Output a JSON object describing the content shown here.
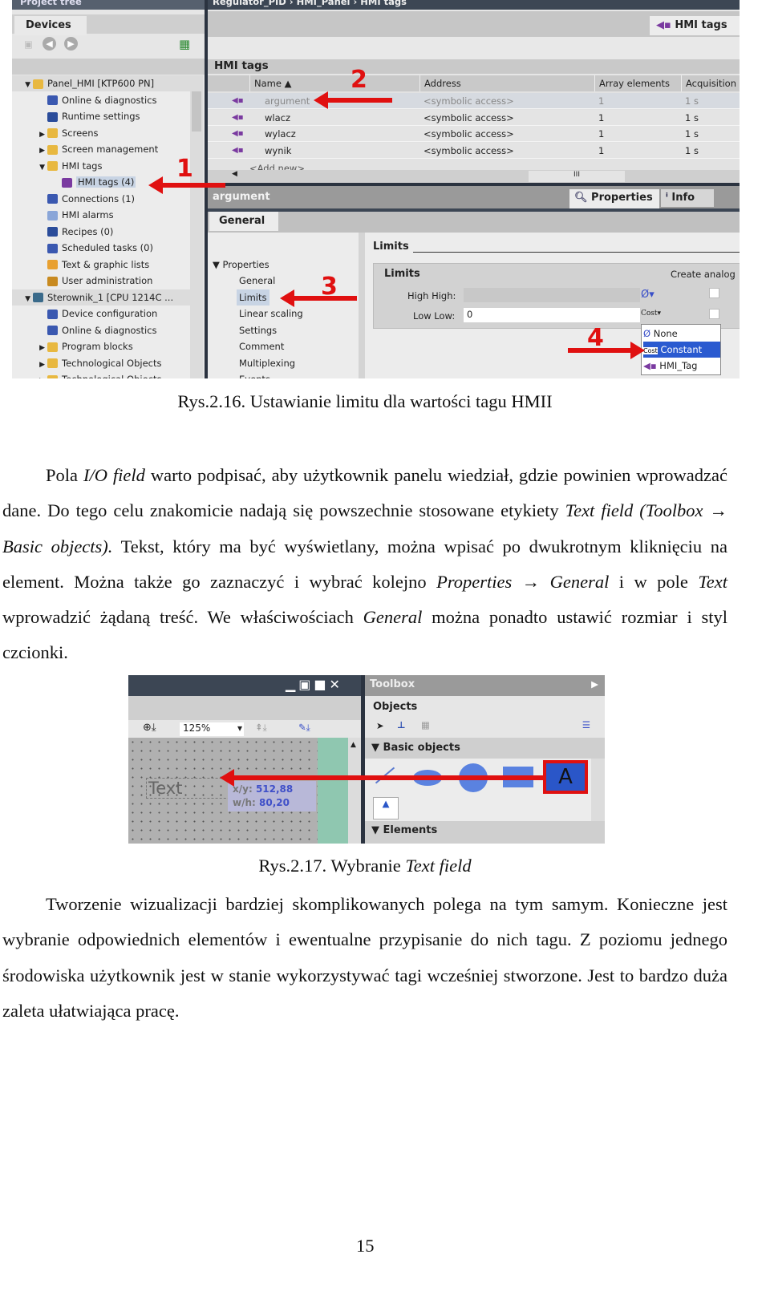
{
  "figure1": {
    "title_bar": "Project tree",
    "breadcrumb": "Regulator_PID  ›  HMI_Panel  ›  HMI tags",
    "devices_tab": "Devices",
    "tree": [
      {
        "label": "Panel_HMI [KTP600 PN]",
        "level": 0,
        "exp": "▼",
        "icon": "folder-icon",
        "color": "#e8b840",
        "sel": true
      },
      {
        "label": "Online & diagnostics",
        "level": 1,
        "exp": "",
        "icon": "diagnostics-icon",
        "color": "#3a58b0"
      },
      {
        "label": "Runtime settings",
        "level": 1,
        "exp": "",
        "icon": "wrench-icon",
        "color": "#2a4c9a"
      },
      {
        "label": "Screens",
        "level": 1,
        "exp": "▶",
        "icon": "folder-icon",
        "color": "#e8b840"
      },
      {
        "label": "Screen management",
        "level": 1,
        "exp": "▶",
        "icon": "folder-icon",
        "color": "#e8b840"
      },
      {
        "label": "HMI tags",
        "level": 1,
        "exp": "▼",
        "icon": "folder-icon",
        "color": "#e8b840"
      },
      {
        "label": "HMI tags (4)",
        "level": 2,
        "exp": "",
        "icon": "tag-icon",
        "color": "#7a3aa0",
        "hl": true
      },
      {
        "label": "Connections (1)",
        "level": 1,
        "exp": "",
        "icon": "connections-icon",
        "color": "#3a58b0"
      },
      {
        "label": "HMI alarms",
        "level": 1,
        "exp": "",
        "icon": "envelope-icon",
        "color": "#8aa6d8"
      },
      {
        "label": "Recipes (0)",
        "level": 1,
        "exp": "",
        "icon": "recipes-icon",
        "color": "#2a4c9a"
      },
      {
        "label": "Scheduled tasks (0)",
        "level": 1,
        "exp": "",
        "icon": "calendar-icon",
        "color": "#3a58b0"
      },
      {
        "label": "Text & graphic lists",
        "level": 1,
        "exp": "",
        "icon": "list-icon",
        "color": "#e8a030"
      },
      {
        "label": "User administration",
        "level": 1,
        "exp": "",
        "icon": "users-icon",
        "color": "#c88a20"
      },
      {
        "label": "Sterownik_1 [CPU 1214C ...",
        "level": 0,
        "exp": "▼",
        "icon": "cpu-icon",
        "color": "#3a6a8a",
        "sel": true
      },
      {
        "label": "Device configuration",
        "level": 1,
        "exp": "",
        "icon": "device-config-icon",
        "color": "#3a58b0"
      },
      {
        "label": "Online & diagnostics",
        "level": 1,
        "exp": "",
        "icon": "diagnostics-icon",
        "color": "#3a58b0"
      },
      {
        "label": "Program blocks",
        "level": 1,
        "exp": "▶",
        "icon": "folder-icon",
        "color": "#e8b840"
      },
      {
        "label": "Technological Objects",
        "level": 1,
        "exp": "▶",
        "icon": "folder-icon",
        "color": "#e8b840"
      },
      {
        "label": "Technological Objects",
        "level": 1,
        "exp": "▶",
        "icon": "folder-icon",
        "color": "#e8b840"
      }
    ],
    "editor_title": "HMI tags",
    "editor_tab": "HMI tags",
    "columns": [
      "Name ▲",
      "Address",
      "Array elements",
      "Acquisition c"
    ],
    "rows": [
      {
        "name": "argument",
        "address": "<symbolic access>",
        "array": "1",
        "acq": "1 s"
      },
      {
        "name": "wlacz",
        "address": "<symbolic access>",
        "array": "1",
        "acq": "1 s"
      },
      {
        "name": "wylacz",
        "address": "<symbolic access>",
        "array": "1",
        "acq": "1 s"
      },
      {
        "name": "wynik",
        "address": "<symbolic access>",
        "array": "1",
        "acq": "1 s"
      }
    ],
    "add_new": "<Add new>",
    "inspector_title": "argument",
    "tab_properties": "Properties",
    "tab_info": "Info",
    "general_tab": "General",
    "nav_group": "Properties",
    "nav_items": [
      "General",
      "Limits",
      "Linear scaling",
      "Settings",
      "Comment",
      "Multiplexing",
      "Events"
    ],
    "section_title": "Limits",
    "group_title": "Limits",
    "create_analog": "Create analog",
    "high_high_label": "High High:",
    "low_low_label": "Low Low:",
    "low_low_value": "0",
    "dropdown": [
      "None",
      "Constant",
      "HMI_Tag"
    ],
    "const_icon": "Cost",
    "markers": [
      "1",
      "2",
      "3",
      "4"
    ]
  },
  "caption1": "Rys.2.16. Ustawianie limitu dla wartości tagu HMII",
  "paragraph1": [
    {
      "t": "Pola ",
      "i": false
    },
    {
      "t": "I/O field",
      "i": true
    },
    {
      "t": " warto podpisać, aby użytkownik panelu wiedział, gdzie powinien wprowadzać dane. Do tego celu znakomicie nadają się powszechnie stosowane etykiety ",
      "i": false
    },
    {
      "t": "Text field (Toolbox → Basic objects).",
      "i": true
    },
    {
      "t": " Tekst, który ma być wyświetlany, można wpisać po dwukrotnym kliknięciu na element. Można także go zaznaczyć i wybrać kolejno ",
      "i": false
    },
    {
      "t": "Properties → General",
      "i": true
    },
    {
      "t": " i w pole ",
      "i": false
    },
    {
      "t": "Text",
      "i": true
    },
    {
      "t": " wprowadzić żądaną treść. We właściwościach ",
      "i": false
    },
    {
      "t": "General",
      "i": true
    },
    {
      "t": " można ponadto ustawić rozmiar i styl czcionki.",
      "i": false
    }
  ],
  "figure2": {
    "zoom": "125%",
    "text_object": "Text",
    "xy_label": "x/y:",
    "xy_value": "512,88",
    "wh_label": "w/h:",
    "wh_value": "80,20",
    "toolbox": "Toolbox",
    "objects": "Objects",
    "basic_objects": "Basic objects",
    "elements": "Elements",
    "text_tool": "A"
  },
  "caption2": {
    "prefix": "Rys.2.17. Wybranie ",
    "italic": "Text field"
  },
  "paragraph2": [
    {
      "t": "Tworzenie wizualizacji bardziej skomplikowanych polega na tym samym. Konieczne jest wybranie odpowiednich elementów i ewentualne przypisanie do nich tagu. Z poziomu jednego środowiska użytkownik jest w  stanie wykorzystywać tagi wcześniej stworzone. Jest to bardzo duża zaleta ułatwiająca pracę.",
      "i": false
    }
  ],
  "page_number": "15",
  "colors": {
    "arrow": "#e01010",
    "selection": "#2a5ad0",
    "titlebar": "#3c4654"
  }
}
